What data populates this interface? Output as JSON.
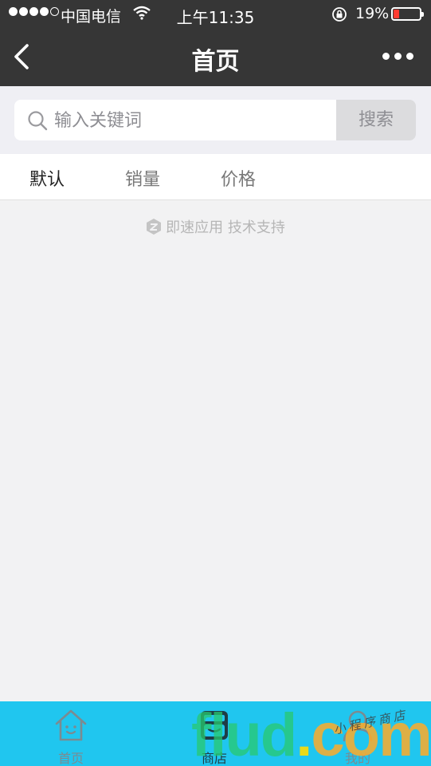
{
  "status_bar": {
    "carrier": "中国电信",
    "time": "上午11:35",
    "battery": "19%",
    "battery_level": 0.19,
    "signal_bars_filled": 4,
    "signal_bars_total": 5
  },
  "navbar": {
    "title": "首页",
    "back_icon": "chevron-left-icon",
    "more_icon": "more-dots-icon"
  },
  "search": {
    "placeholder": "输入关键词",
    "value": "",
    "button_label": "搜索"
  },
  "sort_tabs": [
    {
      "label": "默认",
      "active": true
    },
    {
      "label": "销量",
      "active": false
    },
    {
      "label": "价格",
      "active": false
    }
  ],
  "support_text": "即速应用 技术支持",
  "tabbar": {
    "items": [
      {
        "label": "首页",
        "icon": "house-icon"
      },
      {
        "label": "商店",
        "icon": "store-icon"
      },
      {
        "label": "我的",
        "icon": "user-icon"
      }
    ]
  },
  "watermark": {
    "text": "flud",
    "dot": ".",
    "tld": "com",
    "tagline": "小程序商店"
  },
  "colors": {
    "header_bg": "#363636",
    "tabbar_bg": "#20c6ef",
    "page_bg": "#f2f2f3",
    "battery_low": "#ff3b30"
  }
}
